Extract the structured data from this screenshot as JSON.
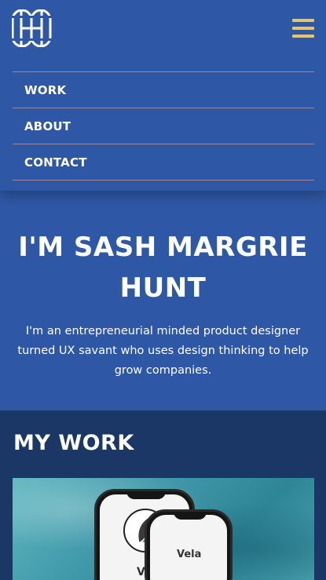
{
  "nav": {
    "items": [
      {
        "label": "WORK"
      },
      {
        "label": "ABOUT"
      },
      {
        "label": "CONTACT"
      }
    ]
  },
  "hero": {
    "title": "I'M SASH MARGRIE HUNT",
    "text": "I'm an entrepreneurial minded product designer turned UX savant who uses design thinking to help grow companies."
  },
  "work": {
    "title": "MY WORK",
    "card": {
      "app_label_back": "Ve",
      "app_label_front": "Vela"
    }
  },
  "colors": {
    "header_bg": "#2e57a5",
    "section_bg": "#1b3765",
    "accent_yellow": "#efc64a",
    "divider": "#b9836f"
  },
  "icons": {
    "logo": "sh-monogram-logo",
    "menu": "hamburger-menu-icon"
  }
}
